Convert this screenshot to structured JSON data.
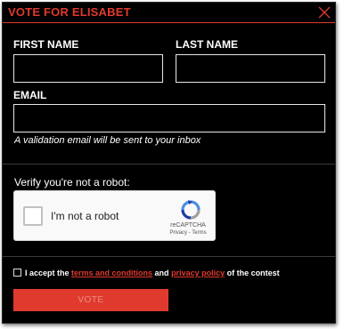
{
  "modal": {
    "title": "VOTE FOR ELISABET",
    "accent_color": "#e03a2f",
    "close_icon": "close-icon"
  },
  "form": {
    "first_name_label": "FIRST NAME",
    "first_name_value": "",
    "last_name_label": "LAST NAME",
    "last_name_value": "",
    "email_label": "EMAIL",
    "email_value": "",
    "email_hint": "A validation email will be sent to your inbox"
  },
  "captcha": {
    "prompt": "Verify you're not a robot:",
    "checkbox_label": "I'm not a robot",
    "brand": "reCAPTCHA",
    "privacy": "Privacy",
    "separator": " - ",
    "terms": "Terms"
  },
  "consent": {
    "prefix": "I accept the ",
    "terms_link": "terms and conditions",
    "middle": " and ",
    "privacy_link": "privacy policy",
    "suffix": " of the contest"
  },
  "vote_button": "VOTE"
}
